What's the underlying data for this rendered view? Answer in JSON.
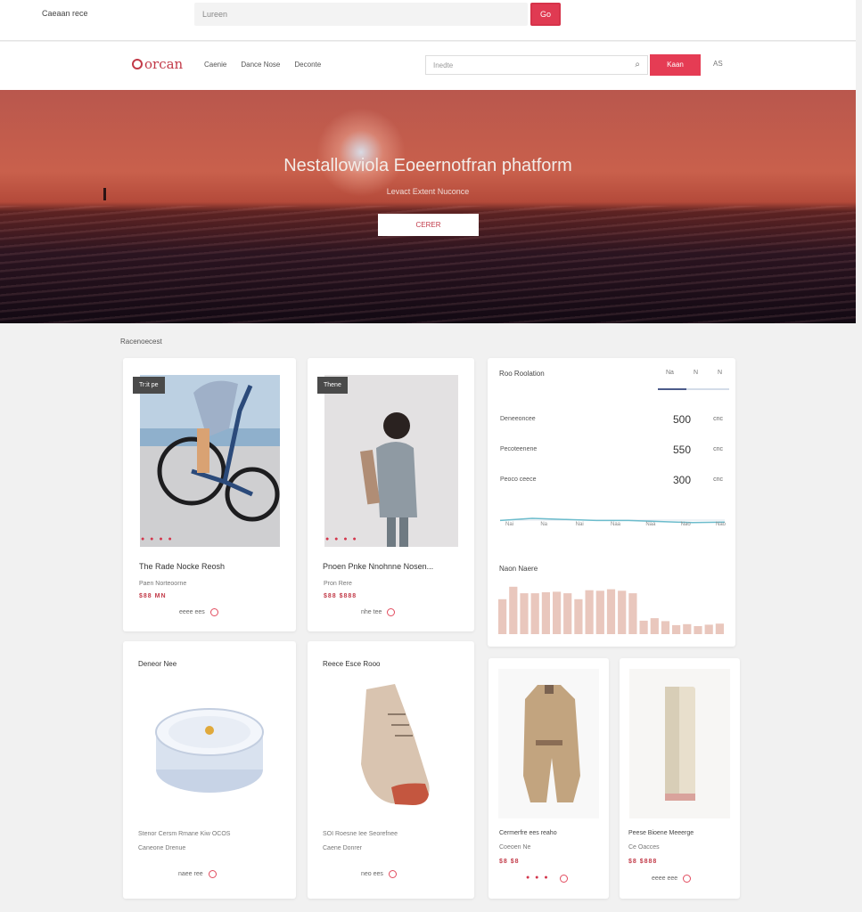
{
  "topbar": {
    "site_label": "Caeaan rece",
    "url_text": "Lureen",
    "go_label": "Go"
  },
  "nav": {
    "logo_text": "orcan",
    "links": [
      "Caenie",
      "Dance Nose",
      "Deconte"
    ],
    "search_placeholder": "Inedte",
    "cta_label": "Kaan",
    "lang_label": "AS"
  },
  "hero": {
    "title": "Nestallowiola Eoeernotfran phatform",
    "subtitle": "Levact Extent Nuconce",
    "button_label": "CERER"
  },
  "section_label": "Racenoecest",
  "products": [
    {
      "badge": "Tr:it pe",
      "title": "The Rade Nocke Reosh",
      "subtitle": "Paen Norteoorne",
      "price": "$88 MN",
      "stars": "● ● ● ●",
      "action": "eeee ees"
    },
    {
      "badge": "Thene",
      "title": "Pnoen Pnke Nnohnne Nosen...",
      "subtitle": "Pron Rere",
      "price": "$88 $888",
      "stars": "● ● ● ●",
      "action": "nhe tee"
    },
    {
      "title": "Deneor Nee",
      "subtitle": "Stenor Cersm Rmane Kiw OCOS",
      "price": "",
      "detail": "Caneone Drenue",
      "action": "naee ree"
    },
    {
      "title": "Reece Esce Rooo",
      "subtitle": "SOI Roesne Iee Seorefnee",
      "price": "",
      "detail": "Caene Donrer",
      "action": "neo ees"
    },
    {
      "title": "Cermerfre ees reaho",
      "subtitle": "Coeoen Ne",
      "price": "$8 $8",
      "stars": "● ● ●",
      "action": ""
    },
    {
      "title": "Peese Bioene Meeerge",
      "subtitle": "Ce Oacces",
      "price": "$8 $888",
      "stars": "",
      "action": "eeee eee"
    }
  ],
  "stats": {
    "title": "Roo Roolation",
    "tabs": [
      "Na",
      "N",
      "N"
    ],
    "rows": [
      {
        "label": "Deneeoncee",
        "value": "500",
        "unit": "cnc"
      },
      {
        "label": "Pecoteenene",
        "value": "550",
        "unit": "cnc"
      },
      {
        "label": "Peoco ceece",
        "value": "300",
        "unit": "cnc"
      }
    ],
    "line_ticks": [
      "Nai",
      "Na",
      "Nai",
      "Naa",
      "Naa",
      "Nao",
      "Nao"
    ],
    "bars_title": "Naon Naere",
    "bars": [
      0.7,
      0.95,
      0.82,
      0.82,
      0.84,
      0.85,
      0.82,
      0.7,
      0.88,
      0.87,
      0.9,
      0.87,
      0.82,
      0.27,
      0.32,
      0.26,
      0.18,
      0.2,
      0.16,
      0.19,
      0.21
    ],
    "line_values": [
      0.52,
      0.6,
      0.56,
      0.52,
      0.52,
      0.48,
      0.44,
      0.46
    ]
  },
  "colors": {
    "accent": "#e53c54",
    "bar": "#e9c7bd",
    "line": "#6cbccc"
  }
}
